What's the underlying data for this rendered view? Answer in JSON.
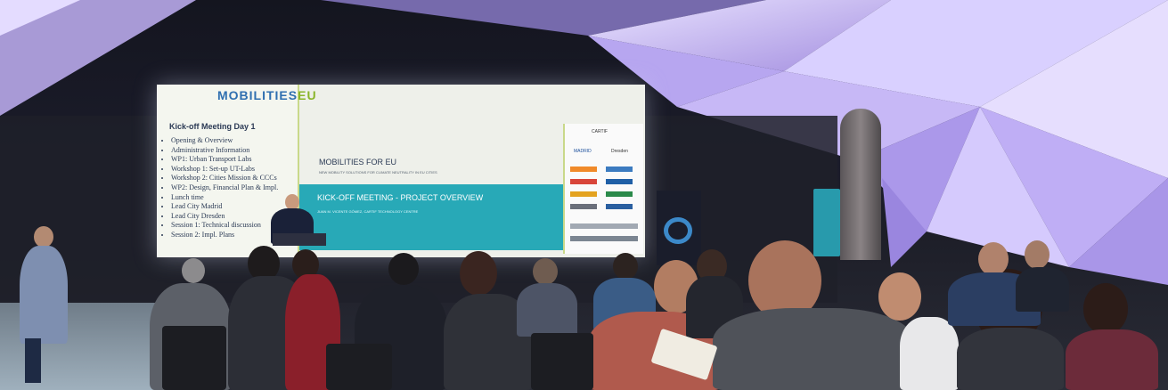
{
  "screen": {
    "logo": "MOBILITIES",
    "logo_suffix": "EU",
    "agenda_title": "Kick-off Meeting Day 1",
    "agenda": [
      "Opening & Overview",
      "Administrative Information",
      "WP1: Urban Transport Labs",
      "Workshop 1: Set-up UT-Labs",
      "Workshop 2: Cities Mission & CCCs",
      "WP2: Design, Financial Plan & Impl.",
      "Lunch time",
      "Lead City Madrid",
      "Lead City Dresden",
      "Session 1: Technical discussion",
      "Session 2: Impl. Plans"
    ],
    "main_title": "MOBILITIES FOR EU",
    "main_subtitle": "NEW MOBILITY SOLUTIONS FOR CLIMATE NEUTRALITY IN EU CITIES",
    "section_title": "KICK-OFF MEETING - PROJECT OVERVIEW",
    "section_subtitle": "JUAN M. VICENTE GÓMEZ, CARTIF TECHNOLOGY CENTRE",
    "partner_labels": [
      "CARTIF",
      "MADRID",
      "Dresden"
    ]
  },
  "colors": {
    "ceiling_light": "#c9b8ff",
    "teal": "#28a9b7",
    "lime": "#8ab52a",
    "navy": "#2b3a55"
  }
}
